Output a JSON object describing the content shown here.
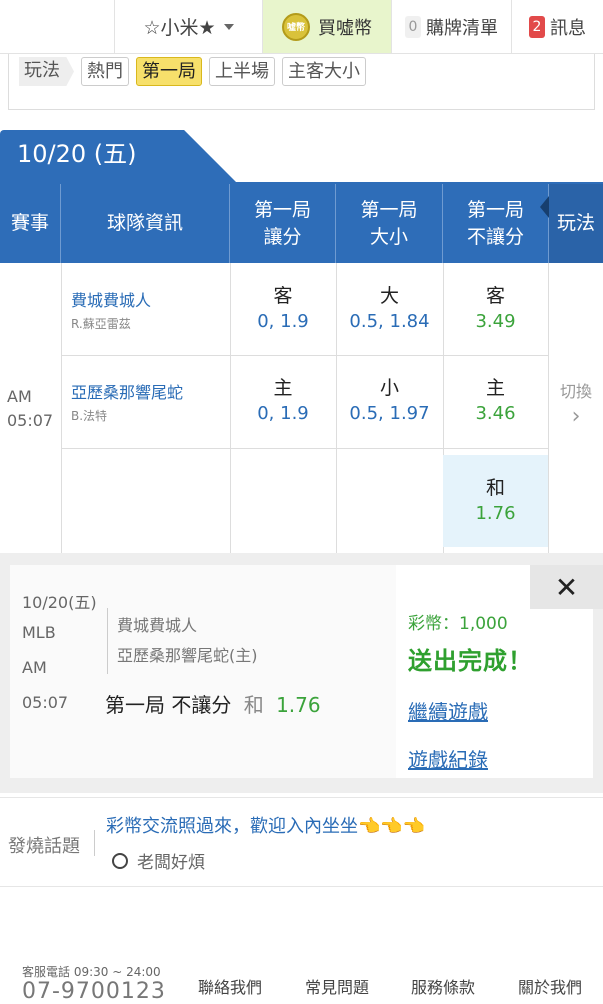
{
  "topbar": {
    "user": "☆小米★",
    "buy_label": "買噓幣",
    "coin_text": "噓幣",
    "cart_count": "0",
    "cart_label": "購牌清單",
    "msg_count": "2",
    "msg_label": "訊息"
  },
  "play_filter": {
    "label": "玩法",
    "chips": [
      "熱門",
      "第一局",
      "上半場",
      "主客大小"
    ],
    "active": "第一局"
  },
  "date_tab": "10/20 (五)",
  "table": {
    "headers": {
      "event": "賽事",
      "team_info": "球隊資訊",
      "col1_l1": "第一局",
      "col1_l2": "讓分",
      "col2_l1": "第一局",
      "col2_l2": "大小",
      "col3_l1": "第一局",
      "col3_l2": "不讓分",
      "play": "玩法"
    },
    "match": {
      "ampm": "AM",
      "time": "05:07",
      "away": {
        "team": "費城費城人",
        "pitcher": "R.蘇亞雷茲"
      },
      "home": {
        "team": "亞歷桑那響尾蛇",
        "pitcher": "B.法特"
      },
      "row1": {
        "spread_sel": "客",
        "spread_odds": "0, 1.9",
        "ou_sel": "大",
        "ou_odds": "0.5, 1.84",
        "ml_sel": "客",
        "ml_odds": "3.49"
      },
      "row2": {
        "spread_sel": "主",
        "spread_odds": "0, 1.9",
        "ou_sel": "小",
        "ou_odds": "0.5, 1.97",
        "ml_sel": "主",
        "ml_odds": "3.46"
      },
      "draw": {
        "sel": "和",
        "odds": "1.76"
      }
    },
    "switch_label": "切換",
    "switch_arrow": "›"
  },
  "ticket": {
    "date": "10/20(五)",
    "league": "MLB",
    "ampm": "AM",
    "time": "05:07",
    "team1": "費城費城人",
    "team2": "亞歷桑那響尾蛇(主)",
    "bet_type": "第一局 不讓分",
    "bet_sel": "和",
    "bet_odds": "1.76",
    "coins": "彩幣：1,000",
    "status": "送出完成！",
    "link_continue": "繼續遊戲",
    "link_history": "遊戲紀錄",
    "close": "✕"
  },
  "hot": {
    "label": "發燒話題",
    "title": "彩幣交流照過來，歡迎入內坐坐",
    "emoji": "👈👈👈",
    "author": "老闆好煩"
  },
  "footer": {
    "service": "客服電話 09:30 ~ 24:00",
    "phone": "07-9700123",
    "links": [
      "聯絡我們",
      "常見問題",
      "服務條款",
      "關於我們"
    ]
  },
  "colors": {
    "header_blue": "#2e6db8",
    "odds_blue": "#2a6cb6",
    "odds_green": "#3ba33b",
    "active_chip": "#f7e06b"
  }
}
